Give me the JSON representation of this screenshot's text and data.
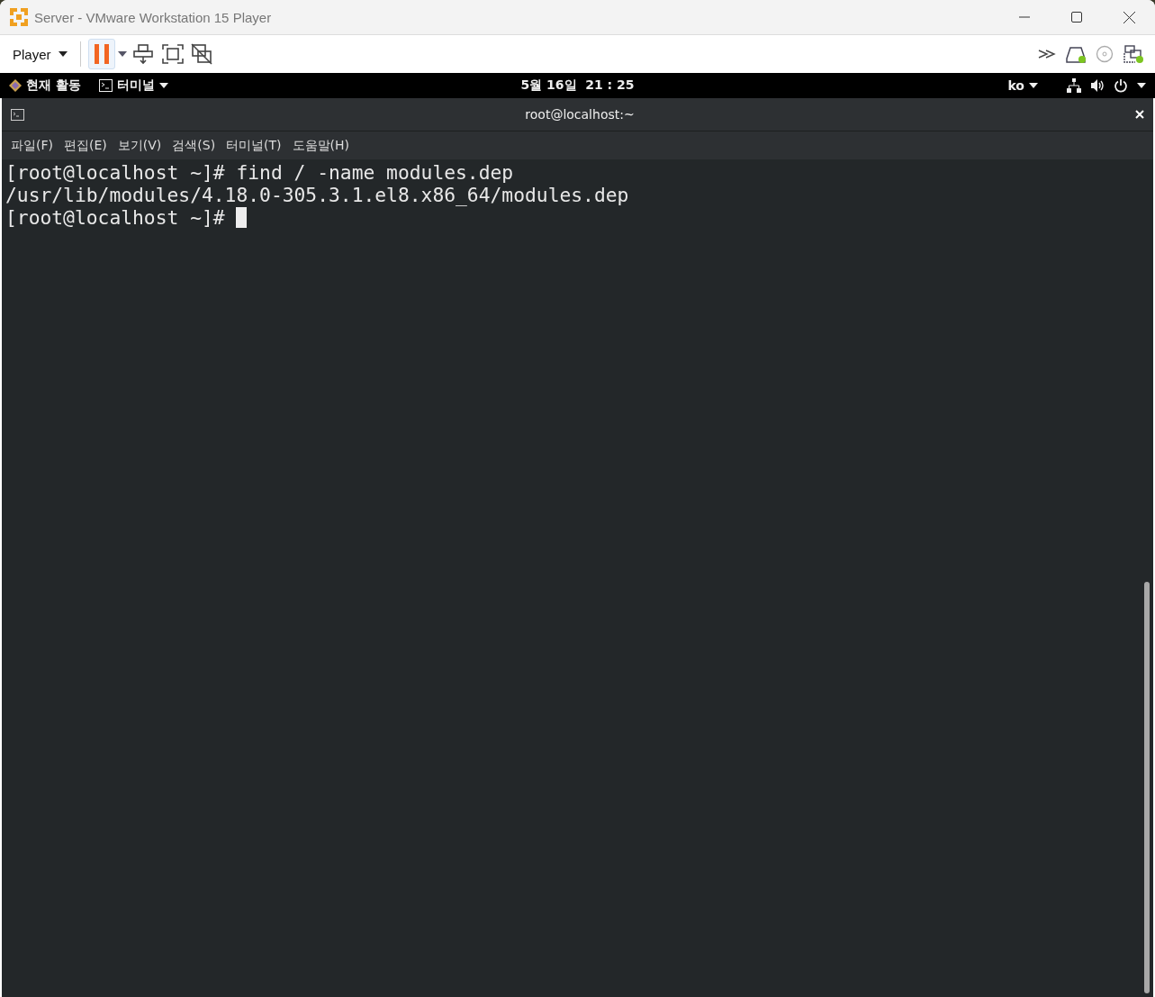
{
  "window": {
    "title": "Server - VMware Workstation 15 Player"
  },
  "toolbar": {
    "player_menu": "Player"
  },
  "top_bar": {
    "activities": "현재 활동",
    "app_menu": "터미널",
    "clock": "5월 16일  21 : 25",
    "input_method": "ko"
  },
  "terminal": {
    "title": "root@localhost:~",
    "menu": [
      "파일(F)",
      "편집(E)",
      "보기(V)",
      "검색(S)",
      "터미널(T)",
      "도움말(H)"
    ],
    "lines": [
      "[root@localhost ~]# find / -name modules.dep",
      "/usr/lib/modules/4.18.0-305.3.1.el8.x86_64/modules.dep",
      "[root@localhost ~]# "
    ]
  }
}
